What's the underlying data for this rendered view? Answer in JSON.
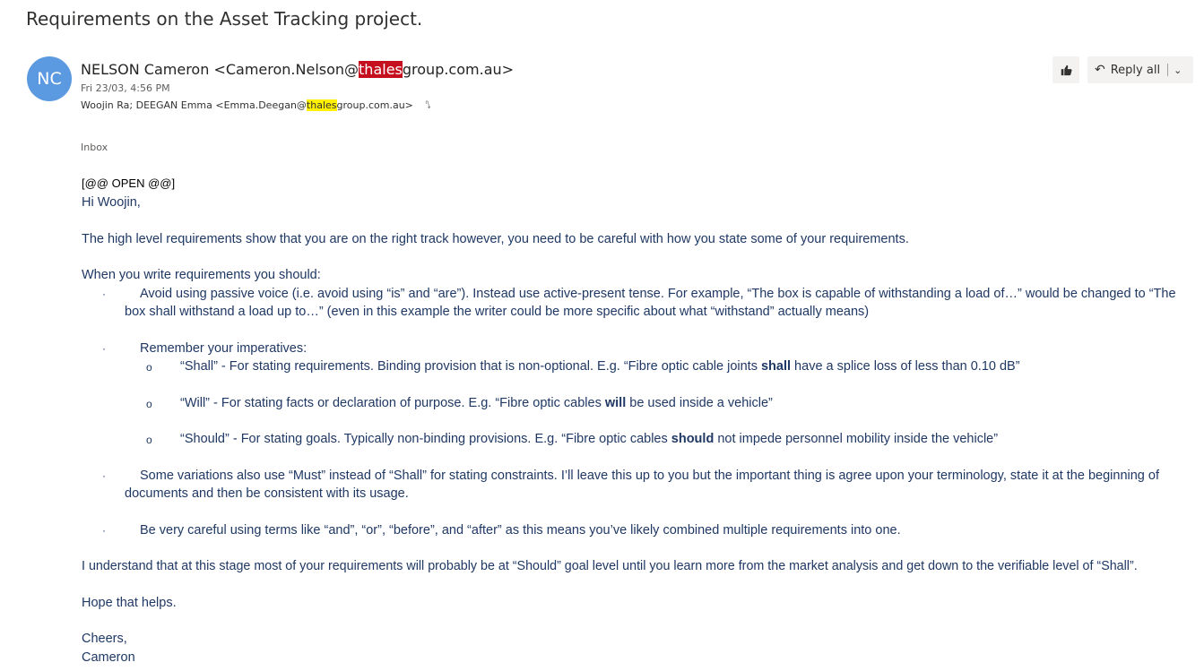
{
  "subject": "Requirements on the Asset Tracking project.",
  "sender": {
    "initials": "NC",
    "name_prefix": "NELSON Cameron <Cameron.Nelson@",
    "highlight": "thales",
    "name_suffix": "group.com.au>"
  },
  "date": "Fri 23/03, 4:56 PM",
  "recipients": {
    "prefix": "Woojin Ra; DEEGAN Emma <Emma.Deegan@",
    "highlight": "thales",
    "suffix": "group.com.au>"
  },
  "actions": {
    "like_icon": "thumbs-up-icon",
    "reply_all_label": "Reply all"
  },
  "folder": "Inbox",
  "body": {
    "open_tag": "[@@ OPEN @@]",
    "greeting": "Hi Woojin,",
    "intro": "The high level requirements show that you are on the right track however, you need to be careful with how you state some of your requirements.",
    "list_intro": "When you write requirements you should:",
    "bullet1": "Avoid using passive voice (i.e. avoid using “is” and “are”). Instead use active-present tense. For example, “The box is capable of withstanding a load of…” would be changed to “The box shall withstand a load up to…” (even in this example the writer could be more specific about what “withstand” actually means)",
    "bullet2": "Remember your  imperatives:",
    "sub1_pre": "“Shall” -  For stating requirements. Binding provision that is non-optional. E.g. “Fibre optic cable joints ",
    "sub1_bold": "shall",
    "sub1_post": " have a splice loss of less than 0.10 dB”",
    "sub2_pre": "“Will” - For stating facts or declaration of purpose. E.g. “Fibre optic cables ",
    "sub2_bold": "will",
    "sub2_post": " be used inside a vehicle”",
    "sub3_pre": "“Should” - For stating goals. Typically non-binding provisions. E.g. “Fibre optic cables ",
    "sub3_bold": "should",
    "sub3_post": " not impede personnel mobility inside the vehicle”",
    "bullet3": "Some variations also use “Must” instead of “Shall” for stating constraints. I’ll leave this up to you but the important thing is agree upon your terminology, state it at the beginning of documents and then be consistent with its usage.",
    "bullet4": "Be very careful using terms like “and”, “or”, “before”, and “after” as this means you’ve likely combined multiple requirements into one.",
    "closing_para": "I understand that at this stage most of your requirements will probably be at “Should” goal level until you learn more from the market analysis and get down to the verifiable level of “Shall”.",
    "hope": "Hope that helps.",
    "signoff": "Cheers,",
    "signature": "Cameron",
    "bullet_glyph": "·",
    "sub_glyph": "o"
  }
}
